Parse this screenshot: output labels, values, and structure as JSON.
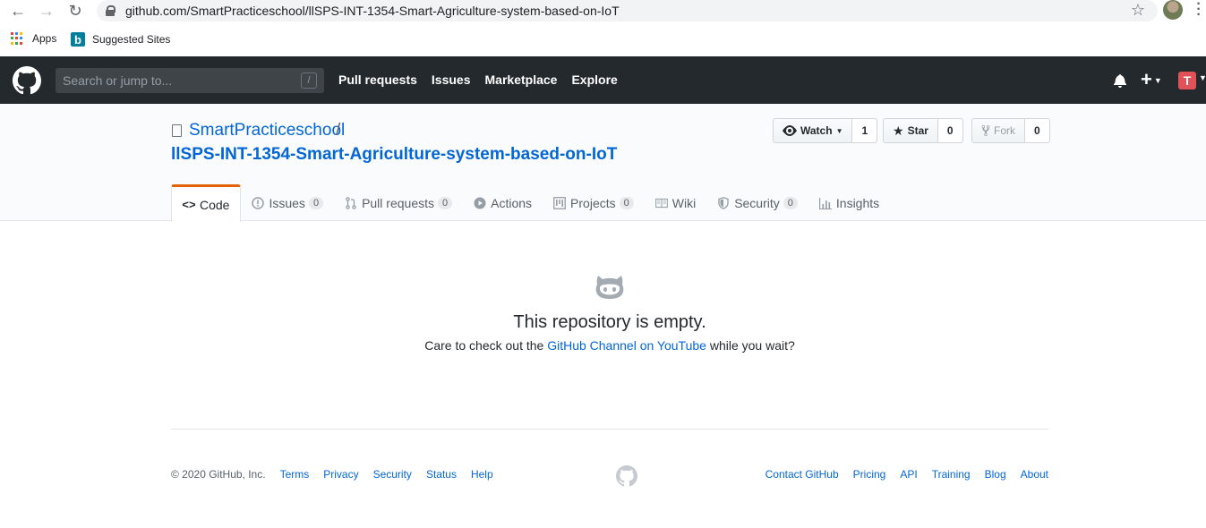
{
  "browser": {
    "url": "github.com/SmartPracticeschool/llSPS-INT-1354-Smart-Agriculture-system-based-on-IoT",
    "bookmarks": [
      {
        "label": "Apps",
        "icon": "apps-grid-icon"
      },
      {
        "label": "Suggested Sites",
        "icon": "bing-icon"
      }
    ]
  },
  "header": {
    "search_placeholder": "Search or jump to...",
    "search_shortcut": "/",
    "nav": [
      "Pull requests",
      "Issues",
      "Marketplace",
      "Explore"
    ],
    "avatar_letter": "T"
  },
  "repo": {
    "owner": "SmartPracticeschool",
    "separator": "/",
    "name": "llSPS-INT-1354-Smart-Agriculture-system-based-on-IoT",
    "watch_label": "Watch",
    "watch_count": "1",
    "star_label": "Star",
    "star_count": "0",
    "fork_label": "Fork",
    "fork_count": "0"
  },
  "tabs": [
    {
      "label": "Code",
      "icon": "code-icon"
    },
    {
      "label": "Issues",
      "count": "0",
      "icon": "issue-icon"
    },
    {
      "label": "Pull requests",
      "count": "0",
      "icon": "pull-request-icon"
    },
    {
      "label": "Actions",
      "icon": "play-icon"
    },
    {
      "label": "Projects",
      "count": "0",
      "icon": "project-icon"
    },
    {
      "label": "Wiki",
      "icon": "book-icon"
    },
    {
      "label": "Security",
      "count": "0",
      "icon": "shield-icon"
    },
    {
      "label": "Insights",
      "icon": "graph-icon"
    }
  ],
  "empty": {
    "title": "This repository is empty.",
    "desc_before": "Care to check out the ",
    "desc_link": "GitHub Channel on YouTube",
    "desc_after": " while you wait?"
  },
  "footer": {
    "copyright": "© 2020 GitHub, Inc.",
    "left_links": [
      "Terms",
      "Privacy",
      "Security",
      "Status",
      "Help"
    ],
    "right_links": [
      "Contact GitHub",
      "Pricing",
      "API",
      "Training",
      "Blog",
      "About"
    ]
  },
  "colors": {
    "header_bg": "#24292e",
    "link": "#0366d6",
    "active_tab_accent": "#e36209"
  }
}
